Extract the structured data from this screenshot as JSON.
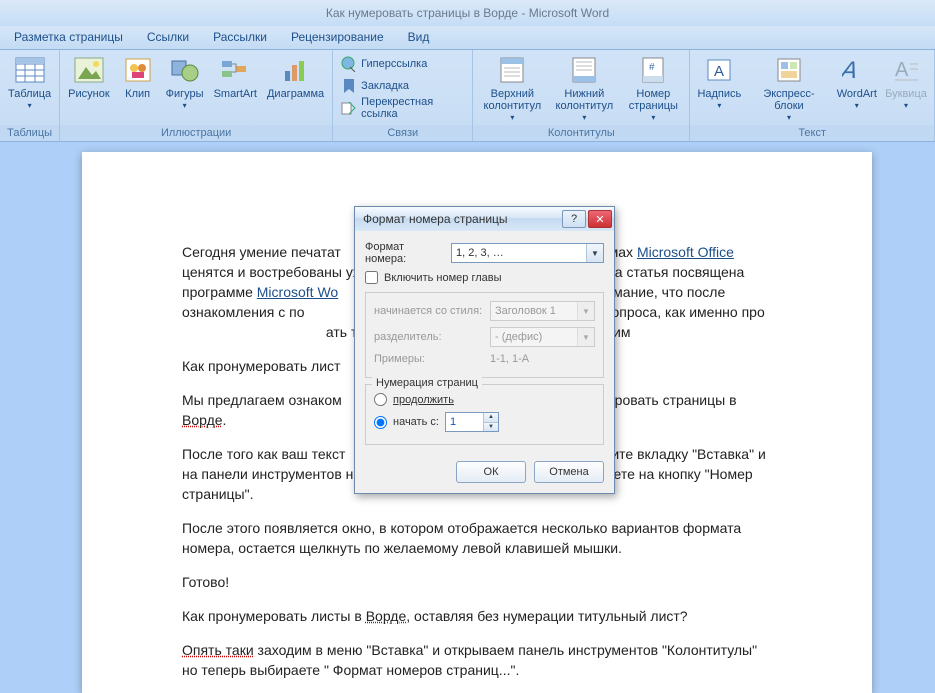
{
  "title": "Как нумеровать страницы в Ворде - Microsoft Word",
  "tabs": [
    "Разметка страницы",
    "Ссылки",
    "Рассылки",
    "Рецензирование",
    "Вид"
  ],
  "ribbon": {
    "tables": {
      "label": "Таблицы",
      "btn": "Таблица"
    },
    "illus": {
      "label": "Иллюстрации",
      "b1": "Рисунок",
      "b2": "Клип",
      "b3": "Фигуры",
      "b4": "SmartArt",
      "b5": "Диаграмма"
    },
    "links": {
      "label": "Связи",
      "b1": "Гиперссылка",
      "b2": "Закладка",
      "b3": "Перекрестная ссылка"
    },
    "hf": {
      "label": "Колонтитулы",
      "b1": "Верхний\nколонтитул",
      "b2": "Нижний\nколонтитул",
      "b3": "Номер\nстраницы"
    },
    "text": {
      "label": "Текст",
      "b1": "Надпись",
      "b2": "Экспресс-блоки",
      "b3": "WordArt",
      "b4": "Буквица"
    }
  },
  "doc": {
    "p1a": "Сегодня умение печатат",
    "p1b": "мах ",
    "p1c": "Microsoft Office",
    "p1d": " ценятся и востребованы уже в шко",
    "p1e": "Эта статья посвящена программе ",
    "p1f": "Microsoft Wo",
    "p1g": "ы. Обратите внимание, что после ознакомления с по",
    "p1h": "ьше никогда не возникнет вопроса, как именно про",
    "p1i": "ать титульный лист и оглавление, если оно им",
    "p2": "Как пронумеровать лист",
    "p3a": "Мы предлагаем ознаком",
    "p3b": "пронумеровать страницы в ",
    "p3c": "Ворде",
    "p3d": ".",
    "p4": "После того как ваш текст",
    "p4b": "дите вкладку \"Вставка\" и на панели инструментов найдите панель \"Колонтитулы\" и нажимаете на кнопку \"Номер страницы\".",
    "p5": "После этого появляется окно, в котором отображается несколько вариантов формата номера, остается щелкнуть по желаемому левой клавишей мышки.",
    "p6": "Готово!",
    "p7a": "Как пронумеровать листы в ",
    "p7b": "Ворде",
    "p7c": ", оставляя без нумерации титульный лист?",
    "p8a": "Опять таки",
    "p8b": " заходим в меню \"Вставка\" и открываем панель инструментов \"Колонтитулы\" но теперь выбираете \" Формат номеров страниц...\"."
  },
  "dialog": {
    "title": "Формат номера страницы",
    "fmtLabel": "Формат номера:",
    "fmtValue": "1, 2, 3, …",
    "chkChapter": "Включить номер главы",
    "startsStyle": "начинается со стиля:",
    "startsStyleVal": "Заголовок 1",
    "sep": "разделитель:",
    "sepVal": "-   (дефис)",
    "examples": "Примеры:",
    "examplesVal": "1-1, 1-A",
    "pagingLegend": "Нумерация страниц",
    "radioCont": "продолжить",
    "radioStart": "начать с:",
    "startVal": "1",
    "ok": "ОК",
    "cancel": "Отмена"
  }
}
